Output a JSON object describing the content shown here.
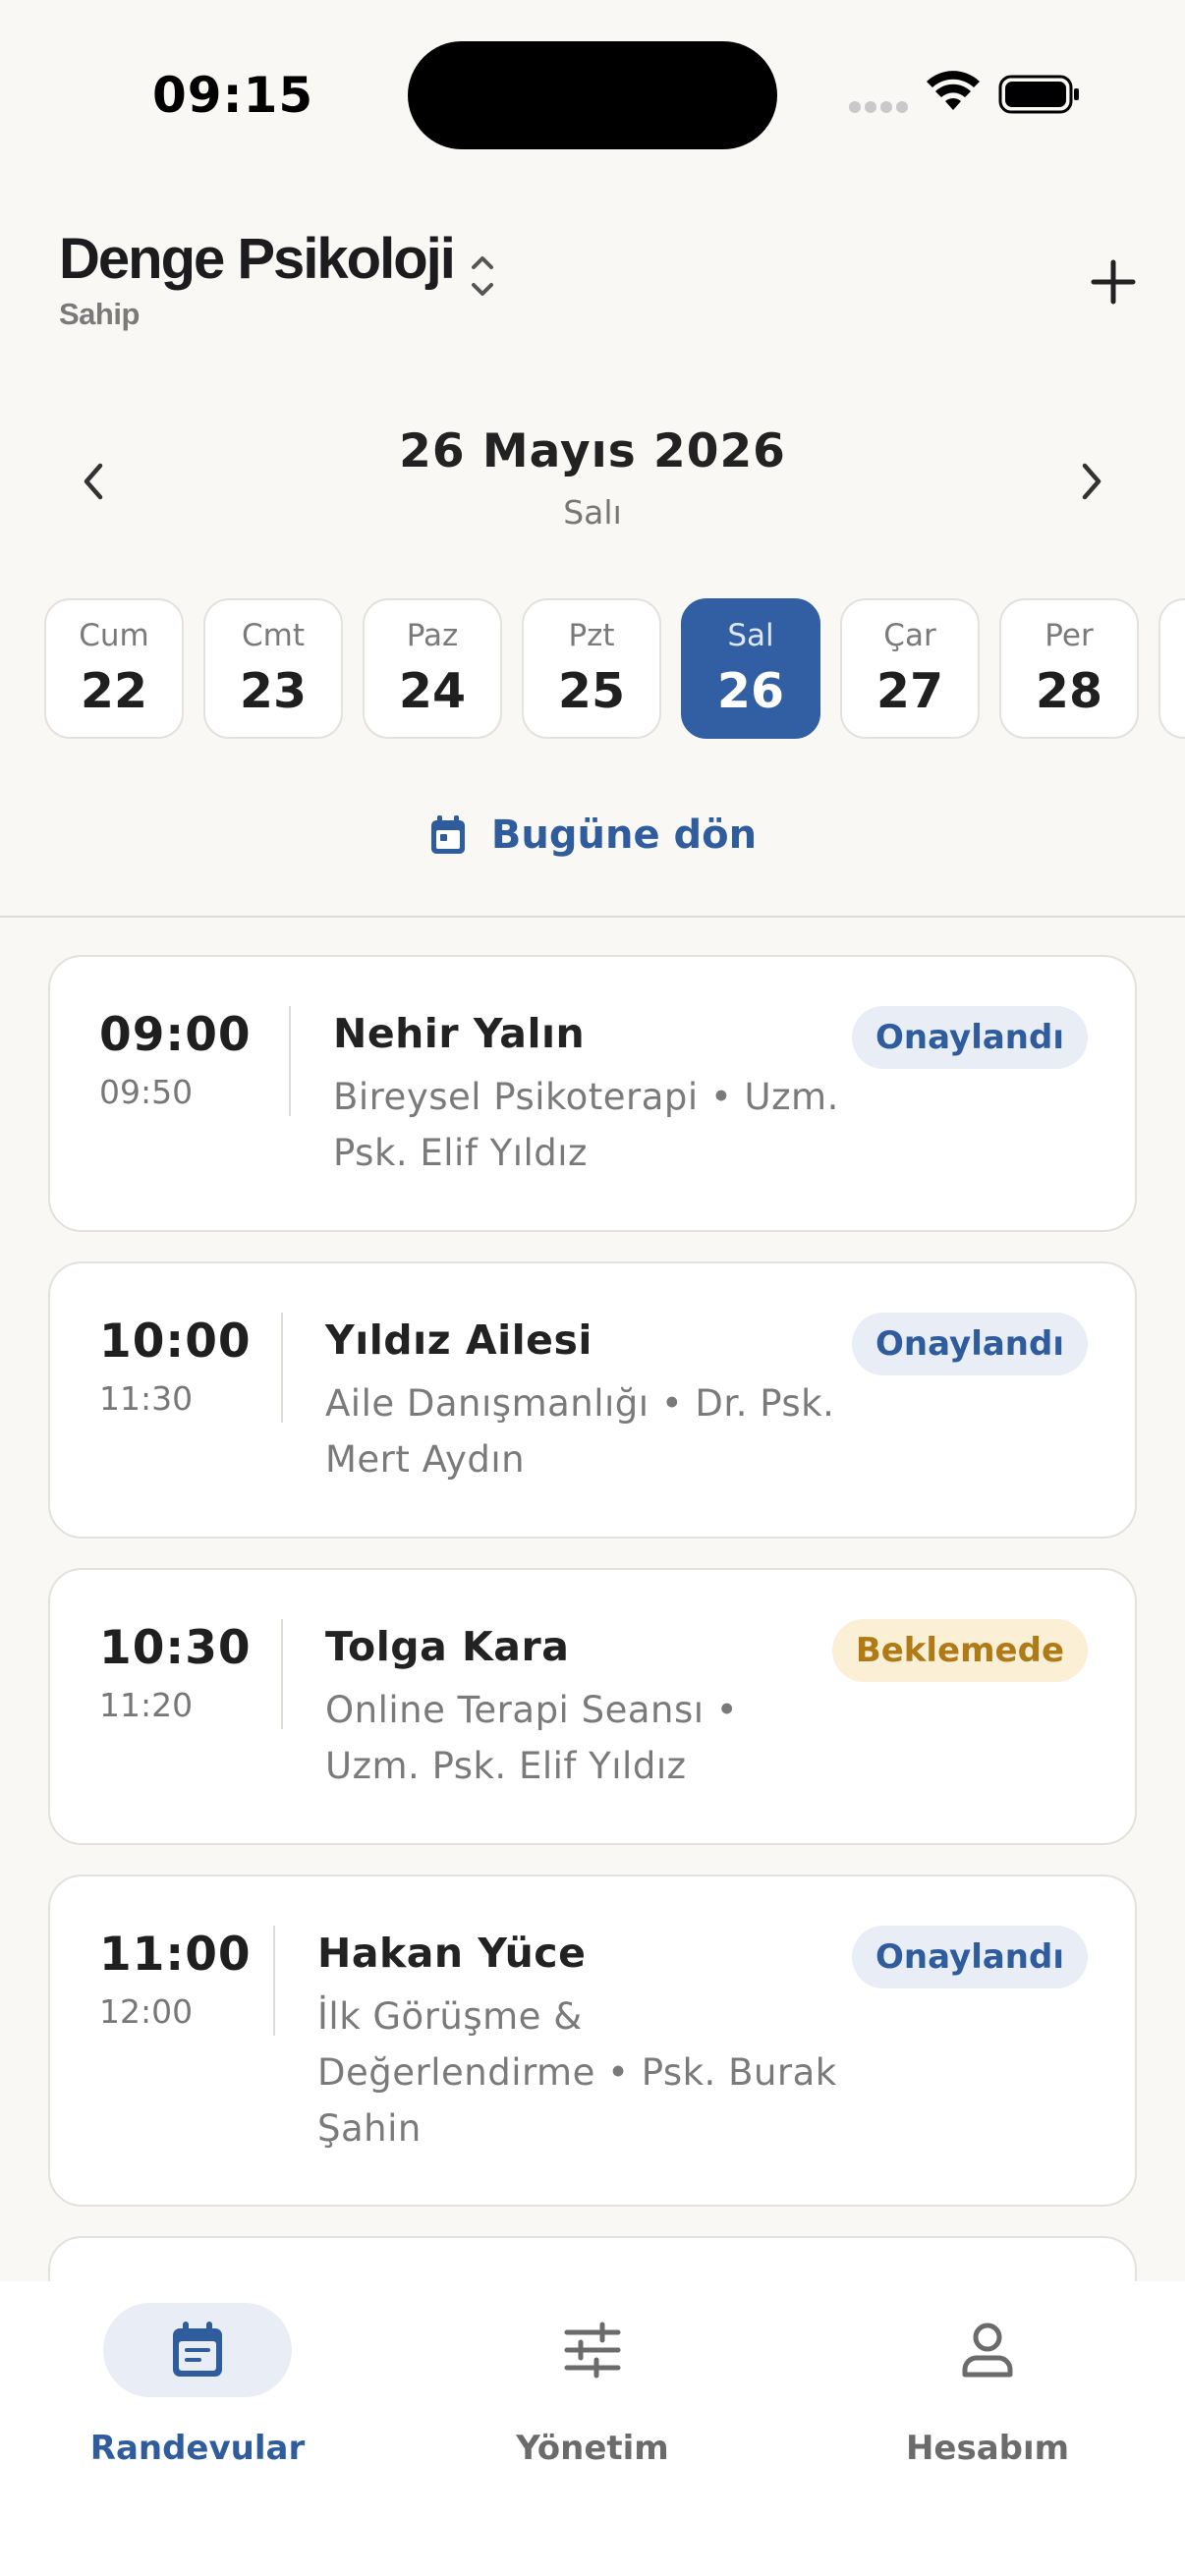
{
  "status": {
    "time": "09:15"
  },
  "header": {
    "title": "Denge Psikoloji",
    "role": "Sahip"
  },
  "date": {
    "main": "26 Mayıs 2026",
    "weekday": "Salı"
  },
  "days": [
    {
      "name": "Cum",
      "num": "22",
      "selected": false
    },
    {
      "name": "Cmt",
      "num": "23",
      "selected": false
    },
    {
      "name": "Paz",
      "num": "24",
      "selected": false
    },
    {
      "name": "Pzt",
      "num": "25",
      "selected": false
    },
    {
      "name": "Sal",
      "num": "26",
      "selected": true
    },
    {
      "name": "Çar",
      "num": "27",
      "selected": false
    },
    {
      "name": "Per",
      "num": "28",
      "selected": false
    },
    {
      "name": "",
      "num": "",
      "selected": false
    }
  ],
  "today_link": "Bugüne dön",
  "appointments": [
    {
      "start": "09:00",
      "end": "09:50",
      "client": "Nehir Yalın",
      "desc_lines": [
        "Bireysel Psikoterapi • Uzm.",
        "Psk. Elif Yıldız"
      ],
      "status": "Onaylandı",
      "status_kind": "ok"
    },
    {
      "start": "10:00",
      "end": "11:30",
      "client": "Yıldız Ailesi",
      "desc_lines": [
        "Aile Danışmanlığı • Dr. Psk.",
        "Mert Aydın"
      ],
      "status": "Onaylandı",
      "status_kind": "ok"
    },
    {
      "start": "10:30",
      "end": "11:20",
      "client": "Tolga Kara",
      "desc_lines": [
        "Online Terapi Seansı •",
        "Uzm. Psk. Elif Yıldız"
      ],
      "status": "Beklemede",
      "status_kind": "wait"
    },
    {
      "start": "11:00",
      "end": "12:00",
      "client": "Hakan Yüce",
      "desc_lines": [
        "İlk Görüşme &",
        "Değerlendirme • Psk. Burak",
        "Şahin"
      ],
      "status": "Onaylandı",
      "status_kind": "ok"
    }
  ],
  "tabs": [
    {
      "label": "Randevular",
      "icon": "calendar-icon",
      "active": true
    },
    {
      "label": "Yönetim",
      "icon": "sliders-icon",
      "active": false
    },
    {
      "label": "Hesabım",
      "icon": "person-icon",
      "active": false
    }
  ],
  "colors": {
    "accent": "#325fa3",
    "confirmed_bg": "#e8edf6",
    "pending_bg": "#fbefd6",
    "pending_text": "#b07b16",
    "background": "#f9f8f5"
  }
}
